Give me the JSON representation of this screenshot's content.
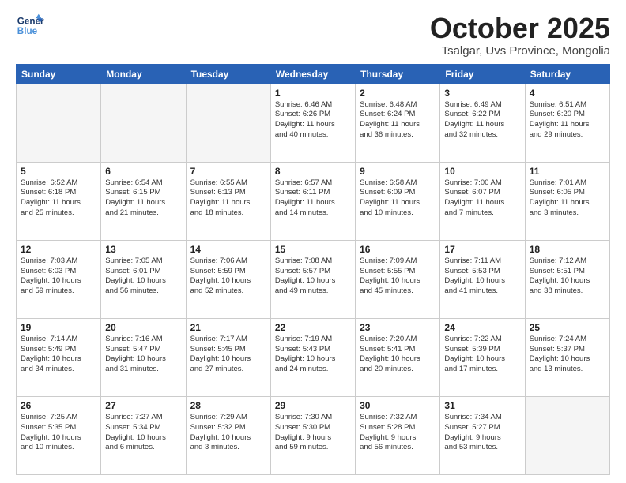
{
  "logo": {
    "line1": "General",
    "line2": "Blue"
  },
  "title": "October 2025",
  "location": "Tsalgar, Uvs Province, Mongolia",
  "days_of_week": [
    "Sunday",
    "Monday",
    "Tuesday",
    "Wednesday",
    "Thursday",
    "Friday",
    "Saturday"
  ],
  "weeks": [
    [
      {
        "day": "",
        "info": ""
      },
      {
        "day": "",
        "info": ""
      },
      {
        "day": "",
        "info": ""
      },
      {
        "day": "1",
        "info": "Sunrise: 6:46 AM\nSunset: 6:26 PM\nDaylight: 11 hours\nand 40 minutes."
      },
      {
        "day": "2",
        "info": "Sunrise: 6:48 AM\nSunset: 6:24 PM\nDaylight: 11 hours\nand 36 minutes."
      },
      {
        "day": "3",
        "info": "Sunrise: 6:49 AM\nSunset: 6:22 PM\nDaylight: 11 hours\nand 32 minutes."
      },
      {
        "day": "4",
        "info": "Sunrise: 6:51 AM\nSunset: 6:20 PM\nDaylight: 11 hours\nand 29 minutes."
      }
    ],
    [
      {
        "day": "5",
        "info": "Sunrise: 6:52 AM\nSunset: 6:18 PM\nDaylight: 11 hours\nand 25 minutes."
      },
      {
        "day": "6",
        "info": "Sunrise: 6:54 AM\nSunset: 6:15 PM\nDaylight: 11 hours\nand 21 minutes."
      },
      {
        "day": "7",
        "info": "Sunrise: 6:55 AM\nSunset: 6:13 PM\nDaylight: 11 hours\nand 18 minutes."
      },
      {
        "day": "8",
        "info": "Sunrise: 6:57 AM\nSunset: 6:11 PM\nDaylight: 11 hours\nand 14 minutes."
      },
      {
        "day": "9",
        "info": "Sunrise: 6:58 AM\nSunset: 6:09 PM\nDaylight: 11 hours\nand 10 minutes."
      },
      {
        "day": "10",
        "info": "Sunrise: 7:00 AM\nSunset: 6:07 PM\nDaylight: 11 hours\nand 7 minutes."
      },
      {
        "day": "11",
        "info": "Sunrise: 7:01 AM\nSunset: 6:05 PM\nDaylight: 11 hours\nand 3 minutes."
      }
    ],
    [
      {
        "day": "12",
        "info": "Sunrise: 7:03 AM\nSunset: 6:03 PM\nDaylight: 10 hours\nand 59 minutes."
      },
      {
        "day": "13",
        "info": "Sunrise: 7:05 AM\nSunset: 6:01 PM\nDaylight: 10 hours\nand 56 minutes."
      },
      {
        "day": "14",
        "info": "Sunrise: 7:06 AM\nSunset: 5:59 PM\nDaylight: 10 hours\nand 52 minutes."
      },
      {
        "day": "15",
        "info": "Sunrise: 7:08 AM\nSunset: 5:57 PM\nDaylight: 10 hours\nand 49 minutes."
      },
      {
        "day": "16",
        "info": "Sunrise: 7:09 AM\nSunset: 5:55 PM\nDaylight: 10 hours\nand 45 minutes."
      },
      {
        "day": "17",
        "info": "Sunrise: 7:11 AM\nSunset: 5:53 PM\nDaylight: 10 hours\nand 41 minutes."
      },
      {
        "day": "18",
        "info": "Sunrise: 7:12 AM\nSunset: 5:51 PM\nDaylight: 10 hours\nand 38 minutes."
      }
    ],
    [
      {
        "day": "19",
        "info": "Sunrise: 7:14 AM\nSunset: 5:49 PM\nDaylight: 10 hours\nand 34 minutes."
      },
      {
        "day": "20",
        "info": "Sunrise: 7:16 AM\nSunset: 5:47 PM\nDaylight: 10 hours\nand 31 minutes."
      },
      {
        "day": "21",
        "info": "Sunrise: 7:17 AM\nSunset: 5:45 PM\nDaylight: 10 hours\nand 27 minutes."
      },
      {
        "day": "22",
        "info": "Sunrise: 7:19 AM\nSunset: 5:43 PM\nDaylight: 10 hours\nand 24 minutes."
      },
      {
        "day": "23",
        "info": "Sunrise: 7:20 AM\nSunset: 5:41 PM\nDaylight: 10 hours\nand 20 minutes."
      },
      {
        "day": "24",
        "info": "Sunrise: 7:22 AM\nSunset: 5:39 PM\nDaylight: 10 hours\nand 17 minutes."
      },
      {
        "day": "25",
        "info": "Sunrise: 7:24 AM\nSunset: 5:37 PM\nDaylight: 10 hours\nand 13 minutes."
      }
    ],
    [
      {
        "day": "26",
        "info": "Sunrise: 7:25 AM\nSunset: 5:35 PM\nDaylight: 10 hours\nand 10 minutes."
      },
      {
        "day": "27",
        "info": "Sunrise: 7:27 AM\nSunset: 5:34 PM\nDaylight: 10 hours\nand 6 minutes."
      },
      {
        "day": "28",
        "info": "Sunrise: 7:29 AM\nSunset: 5:32 PM\nDaylight: 10 hours\nand 3 minutes."
      },
      {
        "day": "29",
        "info": "Sunrise: 7:30 AM\nSunset: 5:30 PM\nDaylight: 9 hours\nand 59 minutes."
      },
      {
        "day": "30",
        "info": "Sunrise: 7:32 AM\nSunset: 5:28 PM\nDaylight: 9 hours\nand 56 minutes."
      },
      {
        "day": "31",
        "info": "Sunrise: 7:34 AM\nSunset: 5:27 PM\nDaylight: 9 hours\nand 53 minutes."
      },
      {
        "day": "",
        "info": ""
      }
    ]
  ]
}
